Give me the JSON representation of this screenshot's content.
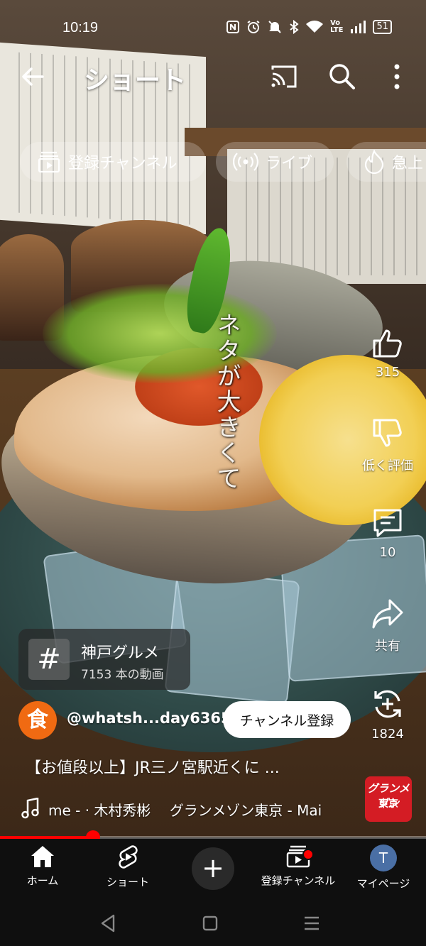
{
  "status_bar": {
    "time": "10:19",
    "icons": [
      "nfc-icon",
      "alarm-icon",
      "mute-icon",
      "bluetooth-icon",
      "wifi-icon",
      "volte-icon",
      "signal-icon",
      "battery-icon"
    ],
    "volte_label": "Vo\nLTE",
    "battery_level": "51"
  },
  "top_bar": {
    "title": "ショート"
  },
  "chips": [
    {
      "label": "登録チャンネル",
      "icon": "subscriptions-icon"
    },
    {
      "label": "ライブ",
      "icon": "live-icon"
    },
    {
      "label": "急上",
      "icon": "trending-icon"
    }
  ],
  "caption": {
    "overlay_text": "ネタが大きくて"
  },
  "actions": {
    "like_count": "315",
    "dislike_label": "低く評価",
    "comment_count": "10",
    "share_label": "共有",
    "remix_count": "1824"
  },
  "hashtag": {
    "symbol": "#",
    "title": "神戸グルメ",
    "subtitle": "7153 本の動画"
  },
  "channel": {
    "avatar_text": "食",
    "handle": "@whatsh...day6365",
    "subscribe_label": "チャンネル登録"
  },
  "video": {
    "title": "【お値段以上】JR三ノ宮駅近くに ..."
  },
  "music": {
    "text": "me - · 木村秀彬　 グランメゾン東京 - Mai",
    "thumb_line1": "グランメゾン",
    "thumb_line2": "東京"
  },
  "progress": {
    "fraction": 0.218
  },
  "bottom_nav": {
    "home_label": "ホーム",
    "shorts_label": "ショート",
    "create_label": "+",
    "subs_label": "登録チャンネル",
    "me_label": "マイページ",
    "me_avatar_letter": "T"
  },
  "colors": {
    "accent": "#ff0000",
    "channel_avatar": "#f06a12",
    "nav_background": "#0f0f0f"
  }
}
